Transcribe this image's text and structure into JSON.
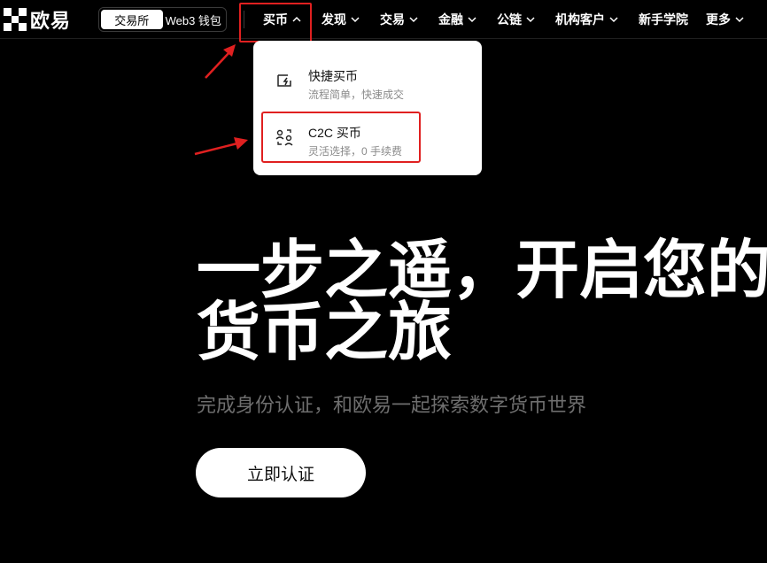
{
  "brand": {
    "name": "欧易"
  },
  "mode_switch": {
    "exchange_label": "交易所",
    "web3_label": "Web3 钱包"
  },
  "nav": {
    "items": [
      {
        "label": "买币"
      },
      {
        "label": "发现"
      },
      {
        "label": "交易"
      },
      {
        "label": "金融"
      },
      {
        "label": "公链"
      },
      {
        "label": "机构客户"
      },
      {
        "label": "新手学院"
      },
      {
        "label": "更多"
      }
    ]
  },
  "dropdown": {
    "items": [
      {
        "title": "快捷买币",
        "subtitle": "流程简单，快速成交",
        "icon": "lightning-card-icon"
      },
      {
        "title": "C2C 买币",
        "subtitle": "灵活选择，0 手续费",
        "icon": "peer-to-peer-icon"
      }
    ]
  },
  "hero": {
    "title_line1": "一步之遥，开启您的",
    "title_line2": "货币之旅",
    "subtitle": "完成身份认证，和欧易一起探索数字货币世界",
    "cta_label": "立即认证"
  },
  "colors": {
    "annotation_red": "#e02020",
    "background": "#000000",
    "subtitle_gray": "#6e6e6e"
  }
}
